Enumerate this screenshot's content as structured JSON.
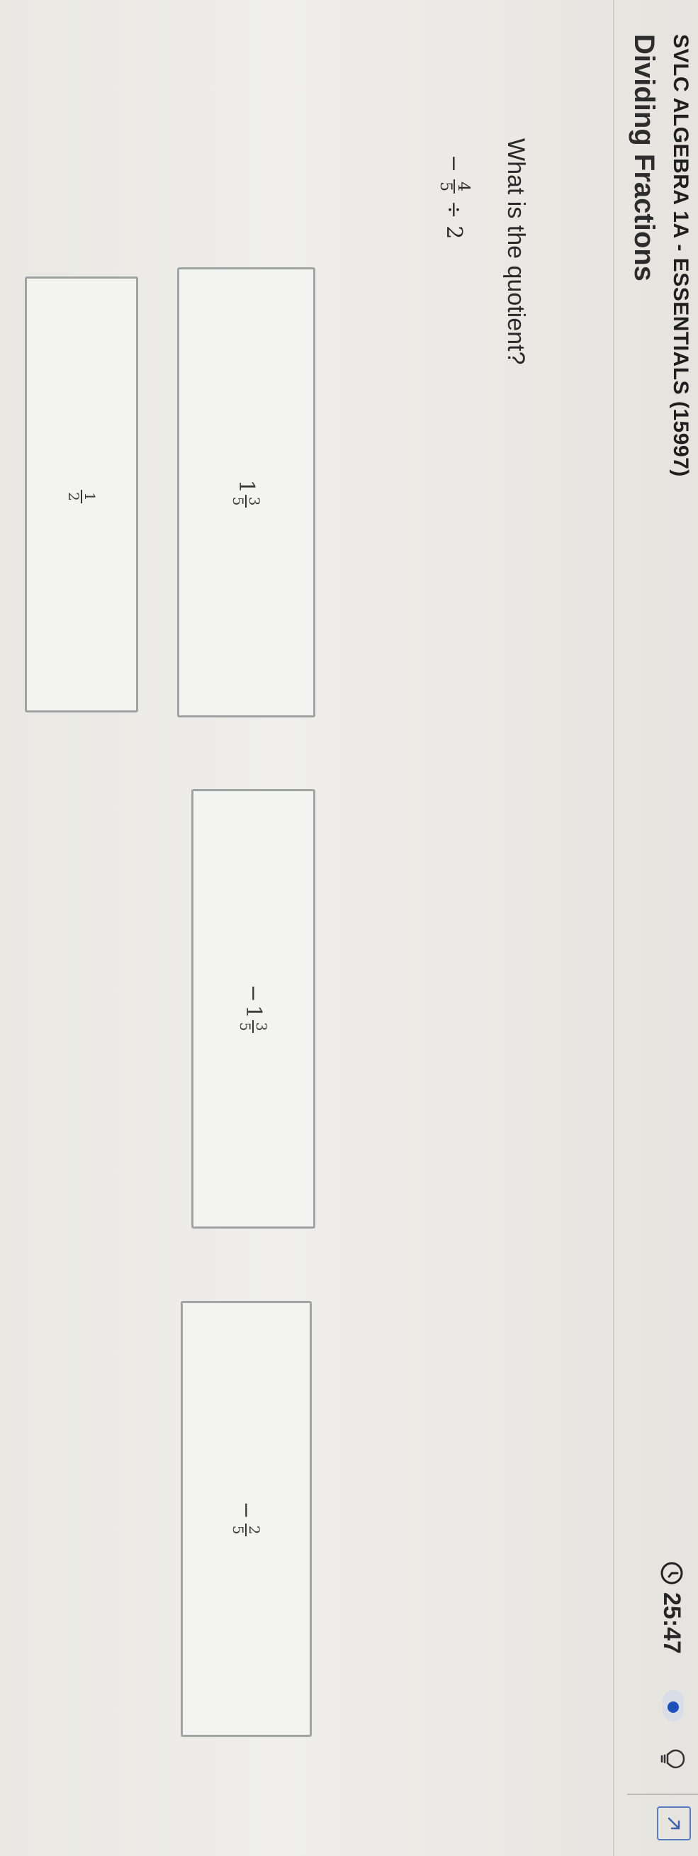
{
  "header": {
    "course_title": "SVLC ALGEBRA 1A - ESSENTIALS (15997)",
    "lesson_title": "Dividing Fractions",
    "timer": "25:47",
    "icons": {
      "timer": "clock-icon",
      "status": "progress-dot-icon",
      "hint": "lightbulb-icon",
      "expand": "expand-arrow-icon"
    },
    "accent_color": "#1f4fb8"
  },
  "question": {
    "prompt": "What is the quotient?",
    "expression": {
      "sign": "−",
      "numerator": "4",
      "denominator": "5",
      "operator": "÷",
      "divisor": "2"
    }
  },
  "choices": [
    {
      "sign": "",
      "whole": "1",
      "numerator": "3",
      "denominator": "5"
    },
    {
      "sign": "−",
      "whole": "1",
      "numerator": "3",
      "denominator": "5"
    },
    {
      "sign": "−",
      "whole": "",
      "numerator": "2",
      "denominator": "5"
    },
    {
      "sign": "",
      "whole": "",
      "numerator": "1",
      "denominator": "2"
    }
  ]
}
